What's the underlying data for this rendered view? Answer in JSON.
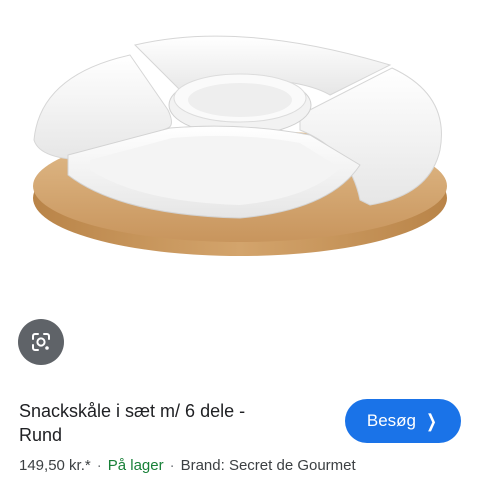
{
  "product": {
    "title_line1": "Snackskåle i sæt m/ 6 dele -",
    "title_line2": "Rund",
    "price": "149,50 kr.*",
    "stock": "På lager",
    "brand": "Brand: Secret de Gourmet"
  },
  "actions": {
    "visit_label": "Besøg",
    "visit_icon": "chevron-right-icon",
    "lens_icon": "google-lens-camera-icon"
  },
  "colors": {
    "accent": "#1a73e8",
    "stock": "#188038",
    "lens_bg": "#5f6368",
    "tray_wood": "#d9ae7a"
  }
}
